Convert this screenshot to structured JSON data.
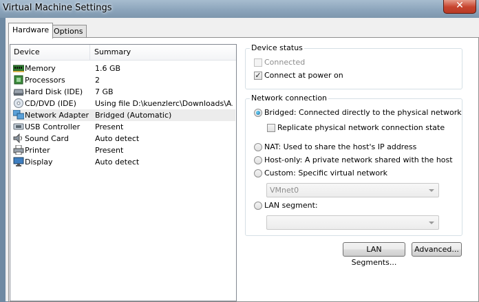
{
  "window": {
    "title": "Virtual Machine Settings",
    "close_glyph": "✕"
  },
  "tabs": [
    {
      "label": "Hardware",
      "active": true
    },
    {
      "label": "Options",
      "active": false
    }
  ],
  "device_list": {
    "headers": {
      "device": "Device",
      "summary": "Summary"
    },
    "rows": [
      {
        "device": "Memory",
        "summary": "1.6 GB",
        "icon": "memory-icon"
      },
      {
        "device": "Processors",
        "summary": "2",
        "icon": "processor-icon"
      },
      {
        "device": "Hard Disk (IDE)",
        "summary": "7 GB",
        "icon": "hard-disk-icon"
      },
      {
        "device": "CD/DVD (IDE)",
        "summary": "Using file D:\\kuenzlerc\\Downloads\\A...",
        "icon": "cd-dvd-icon"
      },
      {
        "device": "Network Adapter",
        "summary": "Bridged (Automatic)",
        "icon": "network-adapter-icon",
        "selected": true
      },
      {
        "device": "USB Controller",
        "summary": "Present",
        "icon": "usb-icon"
      },
      {
        "device": "Sound Card",
        "summary": "Auto detect",
        "icon": "sound-card-icon"
      },
      {
        "device": "Printer",
        "summary": "Present",
        "icon": "printer-icon"
      },
      {
        "device": "Display",
        "summary": "Auto detect",
        "icon": "display-icon"
      }
    ]
  },
  "device_status": {
    "legend": "Device status",
    "connected": {
      "label": "Connected",
      "checked": false,
      "disabled": true
    },
    "connect_at_power_on": {
      "label": "Connect at power on",
      "checked": true
    }
  },
  "network_connection": {
    "legend": "Network connection",
    "bridged": {
      "label": "Bridged: Connected directly to the physical network",
      "selected": true
    },
    "replicate": {
      "label": "Replicate physical network connection state",
      "checked": false
    },
    "nat": {
      "label": "NAT: Used to share the host's IP address",
      "selected": false
    },
    "host_only": {
      "label": "Host-only: A private network shared with the host",
      "selected": false
    },
    "custom": {
      "label": "Custom: Specific virtual network",
      "selected": false,
      "value": "VMnet0"
    },
    "lan_segment": {
      "label": "LAN segment:",
      "selected": false,
      "value": ""
    }
  },
  "buttons": {
    "lan_segments": "LAN Segments...",
    "advanced": "Advanced..."
  },
  "check_glyph": "✓",
  "colors": {
    "selection": "#ececec",
    "radio_dot": "#1b6aa8",
    "close_button": "#c7452f"
  }
}
